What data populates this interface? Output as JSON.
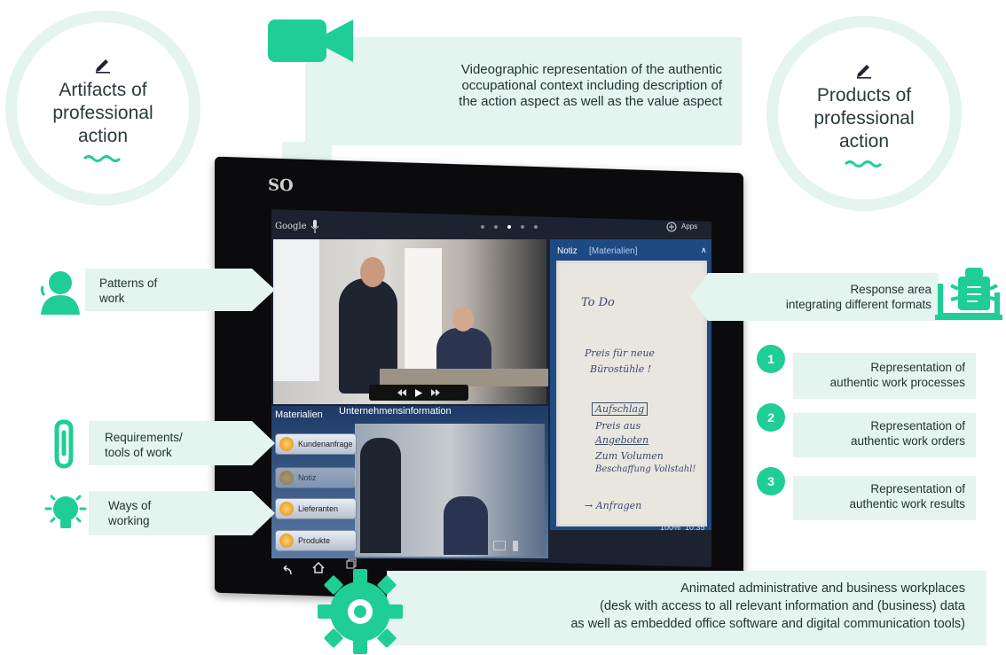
{
  "circles": {
    "left": {
      "title": "Artifacts of\nprofessional\naction"
    },
    "right": {
      "title": "Products of\nprofessional\naction"
    }
  },
  "callouts": {
    "video": "Videographic representation of the authentic\noccupational context including description of\nthe action aspect as well as the value aspect",
    "patterns": "Patterns of\nwork",
    "requirements": "Requirements/\ntools of work",
    "ways": "Ways of\nworking",
    "response": "Response area\nintegrating different formats",
    "rep1": "Representation of\nauthentic work processes",
    "rep2": "Representation of\nauthentic work orders",
    "rep3": "Representation of\nauthentic work results",
    "animated": "Animated administrative and business workplaces\n(desk with access to all relevant information and (business) data\nas well as embedded office software and digital communication tools)"
  },
  "numbers": [
    "1",
    "2",
    "3"
  ],
  "tablet": {
    "brand": "SO",
    "google_label": "Google",
    "apps_label": "Apps",
    "notes_tab": "Notiz",
    "notes_tab_materials": "[Materialien]",
    "notes_lines": [
      "To Do",
      "Preis für neue",
      "Bürostühle !",
      "Aufschlag",
      "Preis aus",
      "Angeboten",
      "Zum Volumen",
      "Beschaffung Vollstahl!",
      "→ Anfragen"
    ],
    "materials_tab": "Materialien",
    "company_tab": "Unternehmensinformation",
    "material_items": [
      "Kundenanfrage",
      "Notiz",
      "Lieferanten",
      "Produkte"
    ],
    "status": "100%  10:35"
  }
}
